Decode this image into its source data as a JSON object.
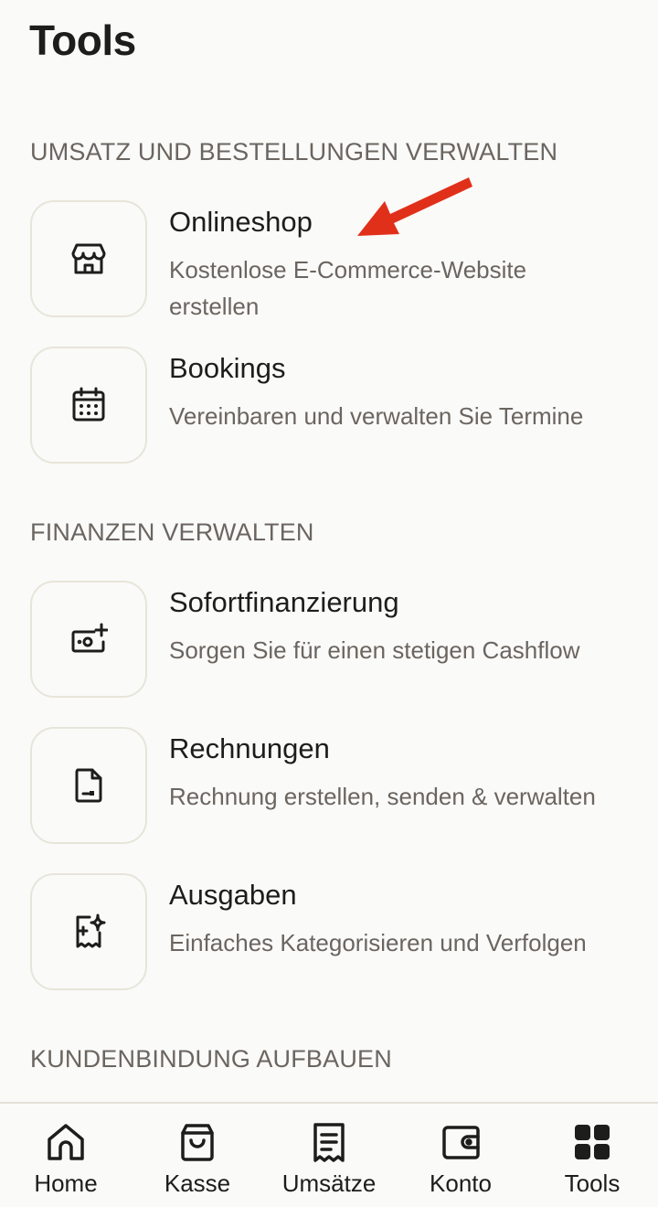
{
  "header": {
    "title": "Tools"
  },
  "sections": [
    {
      "title": "UMSATZ UND BESTELLUNGEN VERWALTEN"
    },
    {
      "title": "FINANZEN VERWALTEN"
    },
    {
      "title": "KUNDENBINDUNG AUFBAUEN"
    }
  ],
  "tools": [
    {
      "icon": "storefront-icon",
      "title": "Onlineshop",
      "description": "Kostenlose E-Commerce-Website erstellen"
    },
    {
      "icon": "calendar-icon",
      "title": "Bookings",
      "description": "Vereinbaren und verwalten Sie Termine"
    },
    {
      "icon": "cash-plus-icon",
      "title": "Sofortfinanzierung",
      "description": "Sorgen Sie für einen stetigen Cashflow"
    },
    {
      "icon": "invoice-icon",
      "title": "Rechnungen",
      "description": "Rechnung erstellen, senden & verwalten"
    },
    {
      "icon": "receipt-sparkle-icon",
      "title": "Ausgaben",
      "description": "Einfaches Kategorisieren und Verfolgen"
    }
  ],
  "annotation": {
    "arrow_color": "#e1301a"
  },
  "bottom_nav": {
    "items": [
      {
        "icon": "home-icon",
        "label": "Home"
      },
      {
        "icon": "shopping-bag-icon",
        "label": "Kasse"
      },
      {
        "icon": "receipt-icon",
        "label": "Umsätze"
      },
      {
        "icon": "wallet-icon",
        "label": "Konto"
      },
      {
        "icon": "grid-icon",
        "label": "Tools"
      }
    ],
    "active": "Tools"
  }
}
